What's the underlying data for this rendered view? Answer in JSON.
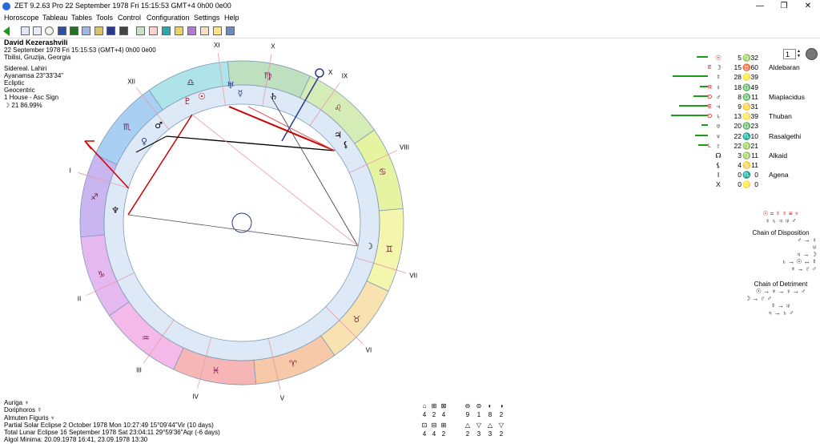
{
  "window": {
    "title": "ZET 9.2.63 Pro   22 September 1978  Fri  15:15:53 GMT+4 0h00  0e00",
    "minimize": "—",
    "maximize": "❐",
    "close": "✕"
  },
  "menu": [
    "Horoscope",
    "Tableau",
    "Tables",
    "Tools",
    "Control",
    "Configuration",
    "Settings",
    "Help"
  ],
  "toolbar": {
    "spin_value": "1"
  },
  "info": {
    "name": "David Kezerashvili",
    "datetime": "22 September 1978  Fri  15:15:53 (GMT+4) 0h00  0e00",
    "place": "Tbilisi, Gruzija, Georgia",
    "zodiac": "Sidereal. Lahiri",
    "ayanamsa": "Ayanamsa 23°33'34\"",
    "coord": "Ecliptic",
    "centric": "Geocentric",
    "house": "1 House - Asc Sign",
    "moon_phase": "☽  21 86.99%"
  },
  "houses": [
    "I",
    "II",
    "III",
    "IV",
    "V",
    "VI",
    "VII",
    "VIII",
    "IX",
    "X",
    "XI",
    "XII"
  ],
  "chart_labels": {
    "mc": "X"
  },
  "planets": [
    {
      "bar": 14,
      "sq": "",
      "sym": "☉",
      "gly": "",
      "deg": "5",
      "sign": "♍",
      "min": "32",
      "star": "",
      "color": "#c00000"
    },
    {
      "bar": 0,
      "sq": "E",
      "sym": "☽",
      "gly": "",
      "deg": "15",
      "sign": "♉",
      "min": "60",
      "star": "Aldebaran",
      "color": "#000"
    },
    {
      "bar": 44,
      "sq": "",
      "sym": "☿",
      "gly": "",
      "deg": "28",
      "sign": "♌",
      "min": "39",
      "star": "",
      "color": "#000"
    },
    {
      "bar": 10,
      "sq": "R",
      "sym": "♀",
      "gly": "",
      "deg": "18",
      "sign": "♎",
      "min": "49",
      "star": "",
      "color": "#000"
    },
    {
      "bar": 18,
      "sq": "D",
      "sym": "♂",
      "gly": "",
      "deg": "8",
      "sign": "♎",
      "min": "11",
      "star": "Miaplacidus",
      "color": "#000"
    },
    {
      "bar": 36,
      "sq": "E",
      "sym": "♃",
      "gly": "",
      "deg": "9",
      "sign": "♋",
      "min": "31",
      "star": "",
      "color": "#000"
    },
    {
      "bar": 46,
      "sq": "D",
      "sym": "♄",
      "gly": "",
      "deg": "13",
      "sign": "♌",
      "min": "39",
      "star": "Thuban",
      "color": "#000"
    },
    {
      "bar": 8,
      "sq": "",
      "sym": "♅",
      "gly": "",
      "deg": "20",
      "sign": "♎",
      "min": "23",
      "star": "",
      "color": "#000"
    },
    {
      "bar": 16,
      "sq": "",
      "sym": "♆",
      "gly": "",
      "deg": "22",
      "sign": "♏",
      "min": "10",
      "star": "Rasalgethi",
      "color": "#000"
    },
    {
      "bar": 12,
      "sq": "L",
      "sym": "♇",
      "gly": "",
      "deg": "22",
      "sign": "♍",
      "min": "21",
      "star": "",
      "color": "#000"
    },
    {
      "bar": 0,
      "sq": "",
      "sym": "☊",
      "gly": "",
      "deg": "3",
      "sign": "♍",
      "min": "11",
      "star": "Alkaid",
      "color": "#000"
    },
    {
      "bar": 0,
      "sq": "",
      "sym": "⚸",
      "gly": "",
      "deg": "4",
      "sign": "♋",
      "min": "11",
      "star": "",
      "color": "#000"
    },
    {
      "bar": 0,
      "sq": "",
      "sym": "I",
      "gly": "",
      "deg": "0",
      "sign": "♏",
      "min": "0",
      "star": "Agena",
      "color": "#000"
    },
    {
      "bar": 0,
      "sq": "",
      "sym": "X",
      "gly": "",
      "deg": "0",
      "sign": "♌",
      "min": "0",
      "star": "",
      "color": "#000"
    }
  ],
  "disposition": {
    "top1": "☉ = ☿ ☿ ≡ ♆",
    "top2": "♀ ♄ ♃ ♅ ♂",
    "title1": "Chain of Disposition",
    "l1": "♂ → ♀",
    "l2": "♅",
    "l3": "♃ → ☽",
    "l4": "♄ → ☉ ↔ ☿",
    "l5": "♆ → ♇ ♂",
    "title2": "Chain of Detriment",
    "d1": "☉ → ♆ → ♀ → ♂",
    "d2": "☽ → ♇ ♂",
    "d3": "☿ → ♅",
    "d4": "♃ → ♄ ♂"
  },
  "bottom": {
    "auriga": "Auriga   ♆",
    "doriphoros": "Doriphoros   ☿",
    "almuten": "Almuten Figuris   ♆",
    "solar": "Partial Solar Eclipse 2 October 1978 Mon 10:27:49 15°09'44\"Vir (10 days)",
    "lunar": "Total Lunar Eclipse 16 September 1978 Sat 23:04:11 29°59'36\"Aqr (-6 days)",
    "algol": "Algol Minima: 20.09.1978 16:41,  23.09.1978 13:30"
  },
  "aspect_stats_1": {
    "icons": [
      "⌂",
      "⊞",
      "⊠",
      "⊖",
      "⊜",
      "◐",
      "◑"
    ],
    "top": [
      "4",
      "2",
      "4",
      "9",
      "1",
      "8",
      "2"
    ]
  },
  "aspect_stats_2": {
    "icons": [
      "⊡",
      "⊟",
      "⊞",
      "△",
      "▽",
      "△",
      "▽"
    ],
    "bottom": [
      "4",
      "4",
      "2",
      "2",
      "3",
      "3",
      "2"
    ]
  },
  "colors": {
    "accent_red": "#cc0000",
    "bar_green": "#1c9a1c"
  }
}
